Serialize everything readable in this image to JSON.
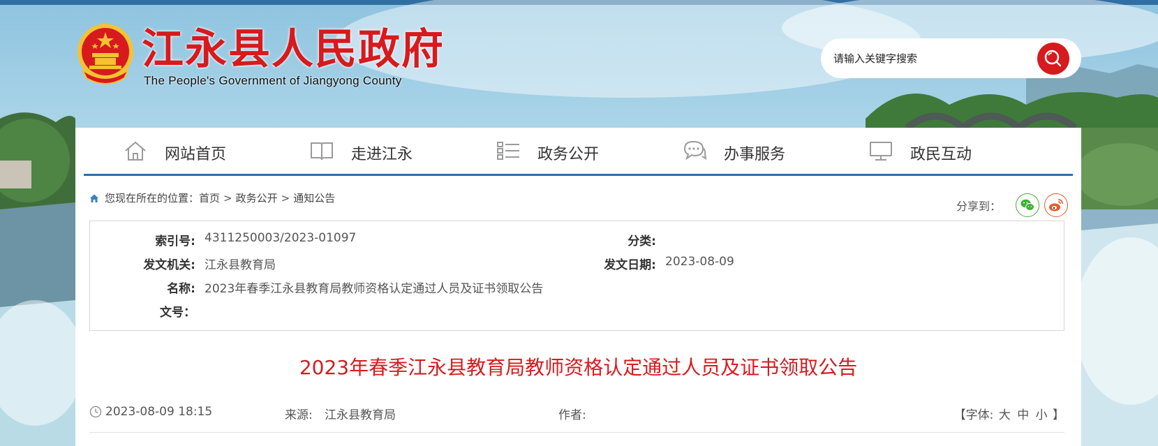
{
  "site": {
    "title": "江永县人民政府",
    "subtitle": "The People's Government of Jiangyong County"
  },
  "search": {
    "placeholder": "请输入关键字搜索"
  },
  "nav": {
    "items": [
      {
        "label": "网站首页",
        "icon": "home-icon"
      },
      {
        "label": "走进江永",
        "icon": "book-icon"
      },
      {
        "label": "政务公开",
        "icon": "list-icon"
      },
      {
        "label": "办事服务",
        "icon": "chat-bubbles-icon"
      },
      {
        "label": "政民互动",
        "icon": "monitor-icon"
      }
    ]
  },
  "breadcrumb": {
    "prefix": "您现在所在的位置：",
    "items": [
      "首页",
      "政务公开",
      "通知公告"
    ],
    "separator": ">"
  },
  "share": {
    "label": "分享到：",
    "wechat": "wechat-icon",
    "weibo": "weibo-icon"
  },
  "meta": {
    "index_label": "索引号:",
    "index_value": "4311250003/2023-01097",
    "category_label": "分类:",
    "category_value": "",
    "issuer_label": "发文机关:",
    "issuer_value": "江永县教育局",
    "date_label": "发文日期:",
    "date_value": "2023-08-09",
    "name_label": "名称:",
    "name_value": "2023年春季江永县教育局教师资格认定通过人员及证书领取公告",
    "docno_label": "文号：",
    "docno_value": ""
  },
  "article": {
    "title": "2023年春季江永县教育局教师资格认定通过人员及证书领取公告",
    "datetime": "2023-08-09 18:15",
    "source_label": "来源:",
    "source_value": "江永县教育局",
    "author_label": "作者:",
    "author_value": "",
    "font_prefix": "【字体:",
    "font_large": "大",
    "font_medium": "中",
    "font_small": "小",
    "font_suffix": "】"
  },
  "colors": {
    "brand_red": "#d71a1e",
    "nav_blue": "#2d6ea8",
    "wechat_green": "#3cb034",
    "weibo_orange": "#e8572a"
  }
}
